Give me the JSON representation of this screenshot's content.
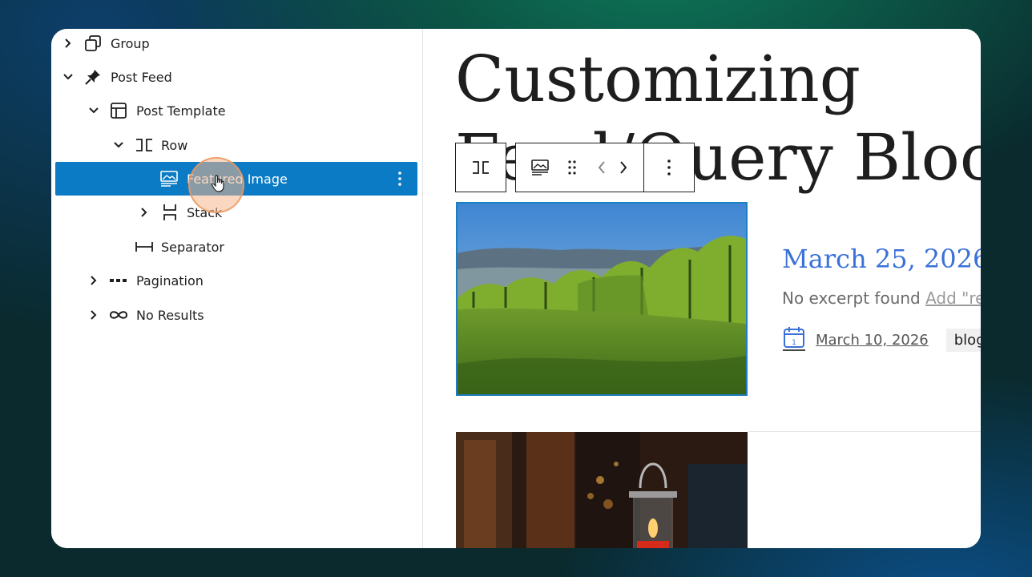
{
  "list_view": {
    "items": [
      {
        "label": "Group"
      },
      {
        "label": "Post Feed"
      },
      {
        "label": "Post Template"
      },
      {
        "label": "Row"
      },
      {
        "label": "Featured Image"
      },
      {
        "label": "Stack"
      },
      {
        "label": "Separator"
      },
      {
        "label": "Pagination"
      },
      {
        "label": "No Results"
      }
    ]
  },
  "canvas": {
    "title_line1": "Customizing",
    "title_line2": "Feed/Query Bloc",
    "post": {
      "title": "March 25, 2026",
      "excerpt": "No excerpt found ",
      "excerpt_link": "Add \"re",
      "date": "March 10, 2026",
      "tag": "blog"
    }
  },
  "colors": {
    "selection": "#0a7bc4",
    "post_title": "#3a71d9",
    "image_border": "#1e7fc0"
  }
}
